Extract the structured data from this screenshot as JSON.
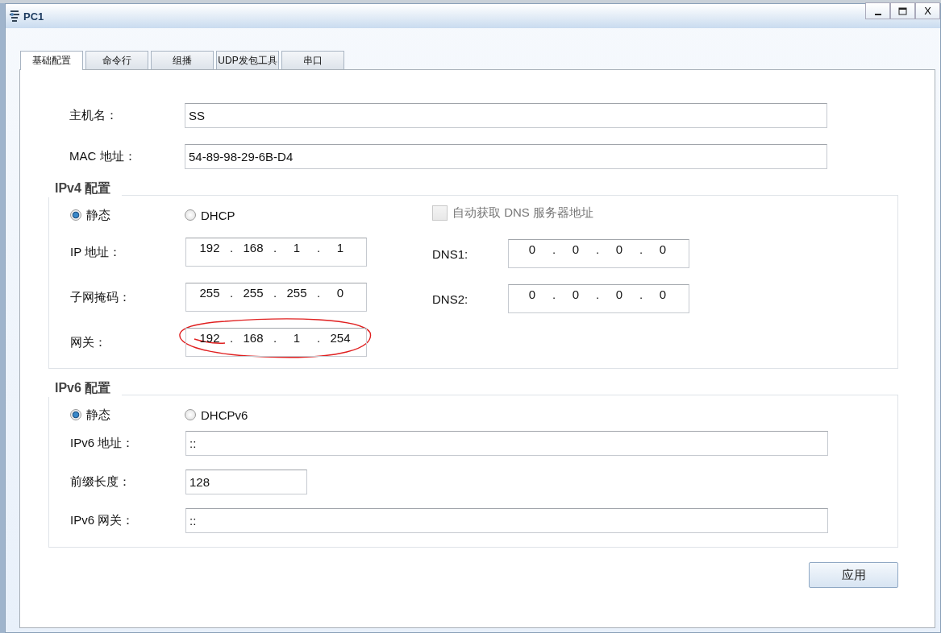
{
  "window": {
    "title": "PC1",
    "close_label": "X"
  },
  "tabs": [
    {
      "label": "基础配置",
      "selected": true
    },
    {
      "label": "命令行",
      "selected": false
    },
    {
      "label": "组播",
      "selected": false
    },
    {
      "label": "UDP发包工具",
      "selected": false
    },
    {
      "label": "串口",
      "selected": false
    }
  ],
  "fields": [
    {
      "label": "主机名：",
      "value": "SS",
      "kind": "wide"
    },
    {
      "label": "MAC 地址：",
      "value": "54-89-98-29-6B-D4",
      "kind": "wide"
    }
  ],
  "ipv4": {
    "title": "IPv4 配置",
    "modes": [
      {
        "label": "静态",
        "selected": true
      },
      {
        "label": "DHCP",
        "selected": false
      }
    ],
    "auto_dns": {
      "label": "自动获取 DNS 服务器地址",
      "checked": false,
      "disabled": true
    },
    "left": [
      {
        "label": "IP 地址：",
        "parts": [
          "192",
          ".",
          "168",
          ".",
          "1",
          ".",
          "1"
        ],
        "highlight": false
      },
      {
        "label": "子网掩码：",
        "parts": [
          "255",
          ".",
          "255",
          ".",
          "255",
          ".",
          "0"
        ],
        "highlight": false
      },
      {
        "label": "网关：",
        "parts": [
          "192",
          ".",
          "168",
          ".",
          "1",
          ".",
          "254"
        ],
        "highlight": true
      }
    ],
    "right": [
      {
        "label": "DNS1:",
        "parts": [
          "0",
          ".",
          "0",
          ".",
          "0",
          ".",
          "0"
        ],
        "highlight": false
      },
      {
        "label": "DNS2:",
        "parts": [
          "0",
          ".",
          "0",
          ".",
          "0",
          ".",
          "0"
        ],
        "highlight": false
      }
    ]
  },
  "ipv6": {
    "title": "IPv6 配置",
    "modes": [
      {
        "label": "静态",
        "selected": true
      },
      {
        "label": "DHCPv6",
        "selected": false
      }
    ],
    "fields": [
      {
        "label": "IPv6 地址：",
        "value": "::",
        "kind": "wide"
      },
      {
        "label": "前缀长度：",
        "value": "128",
        "kind": "short"
      },
      {
        "label": "IPv6 网关：",
        "value": "::",
        "kind": "wide"
      }
    ]
  },
  "apply_button": "应用"
}
